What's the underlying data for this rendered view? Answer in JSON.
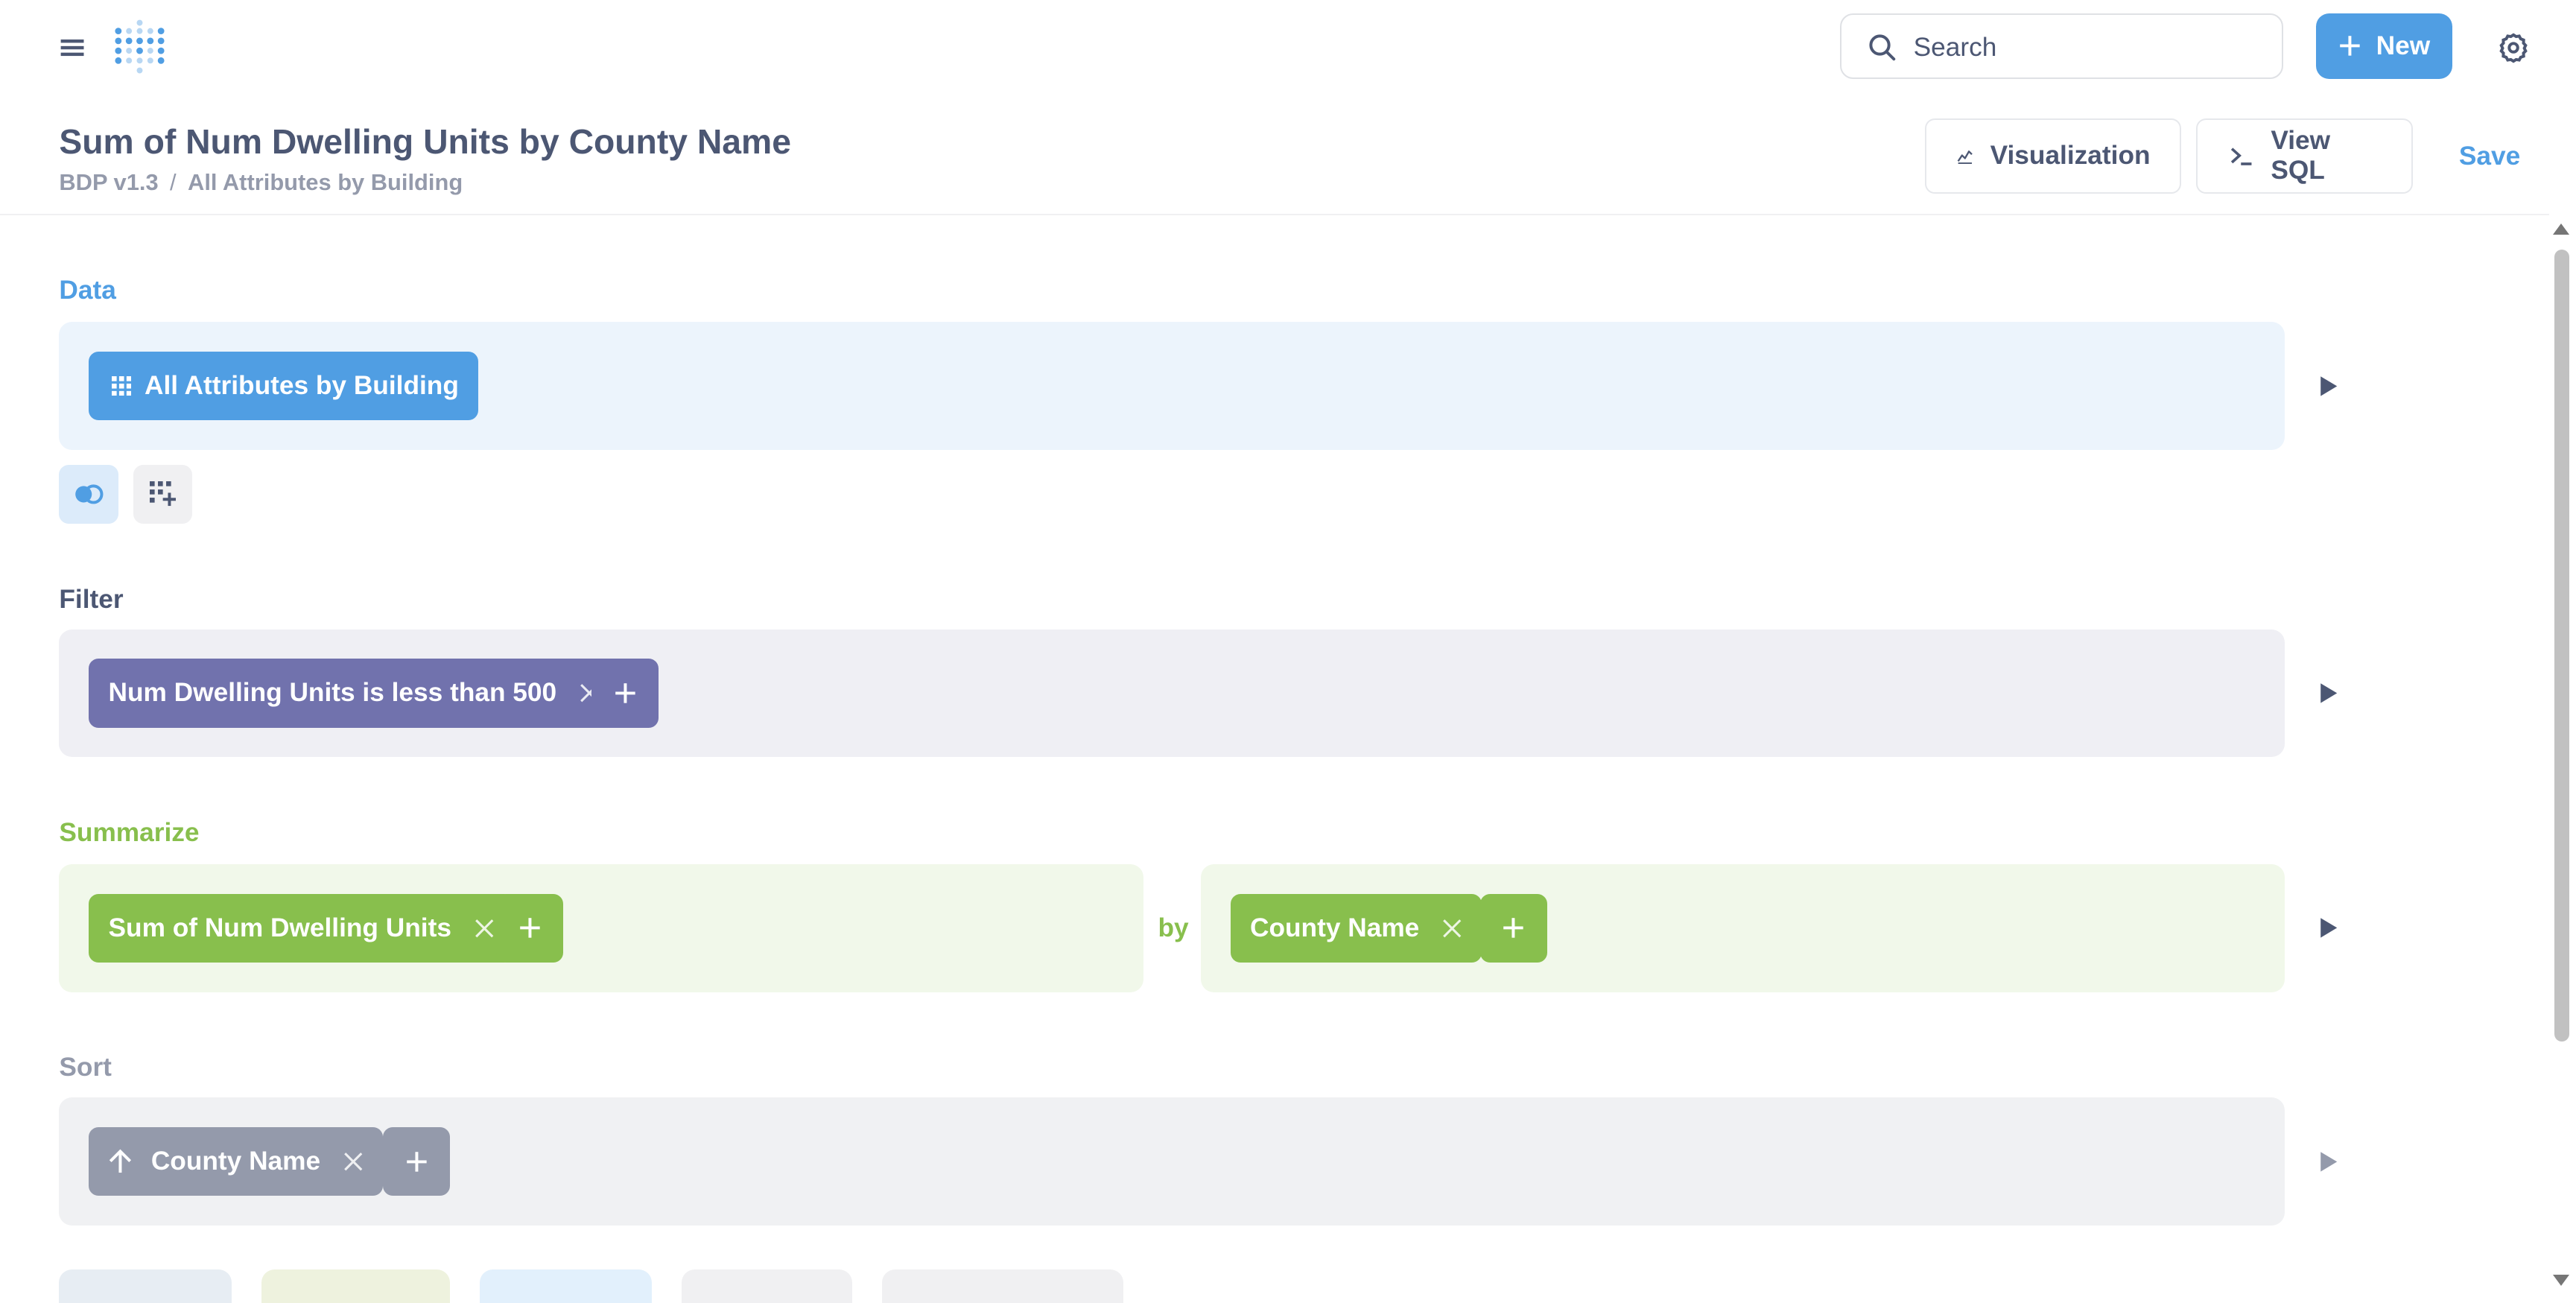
{
  "topbar": {
    "search_placeholder": "Search",
    "new_label": "New"
  },
  "header": {
    "title": "Sum of Num Dwelling Units by County Name",
    "breadcrumb": [
      "BDP v1.3",
      "All Attributes by Building"
    ],
    "breadcrumb_sep": "/",
    "visualization_label": "Visualization",
    "view_sql_label": "View SQL",
    "save_label": "Save"
  },
  "sections": {
    "data": {
      "label": "Data",
      "source": "All Attributes by Building"
    },
    "filter": {
      "label": "Filter",
      "items": [
        "Num Dwelling Units is less than 500"
      ]
    },
    "summarize": {
      "label": "Summarize",
      "metrics": [
        "Sum of Num Dwelling Units"
      ],
      "by_label": "by",
      "breakouts": [
        "County Name"
      ]
    },
    "sort": {
      "label": "Sort",
      "items": [
        "County Name"
      ]
    }
  },
  "colors": {
    "brand": "#509ee3",
    "filter": "#7172ad",
    "summarize": "#88bf4d",
    "sort": "#949aab",
    "text": "#4c5773"
  }
}
